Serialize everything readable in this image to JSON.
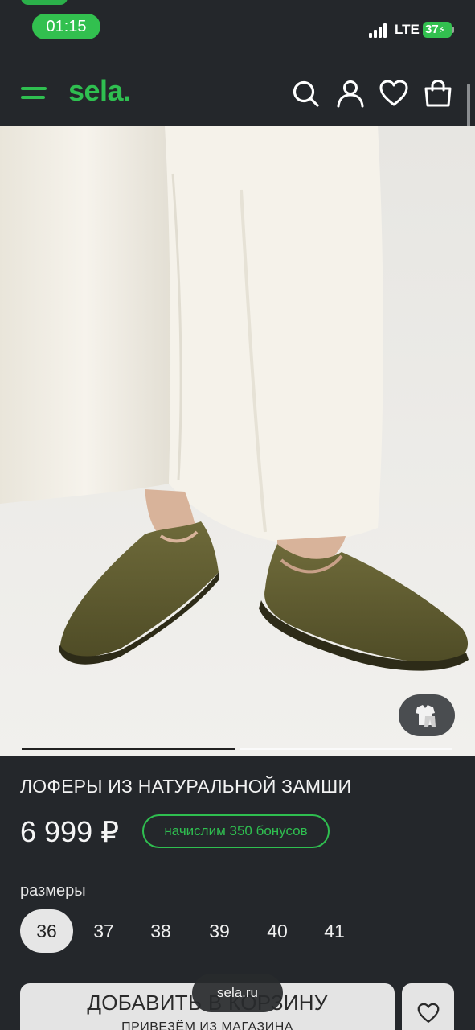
{
  "status_bar": {
    "time": "01:15",
    "network": "LTE",
    "battery": "37"
  },
  "header": {
    "logo": "sela.",
    "icons": [
      "menu-icon",
      "search-icon",
      "user-icon",
      "heart-icon",
      "shopping-bag-icon"
    ]
  },
  "gallery": {
    "current_slide": 1,
    "total_slides": 2
  },
  "product": {
    "title": "ЛОФЕРЫ ИЗ НАТУРАЛЬНОЙ ЗАМШИ",
    "price": "6 999 ₽",
    "bonus": "начислим 350 бонусов",
    "sizes_label": "размеры",
    "sizes": [
      "36",
      "37",
      "38",
      "39",
      "40",
      "41"
    ],
    "selected_size": "36"
  },
  "actions": {
    "add_to_cart": "ДОБАВИТЬ В КОРЗИНУ",
    "delivery_note": "ПРИВЕЗЁМ ИЗ МАГАЗИНА"
  },
  "browser": {
    "url": "sela.ru"
  },
  "colors": {
    "background": "#24272b",
    "brand_green": "#2fbf50",
    "button_bg": "#e4e4e4"
  }
}
